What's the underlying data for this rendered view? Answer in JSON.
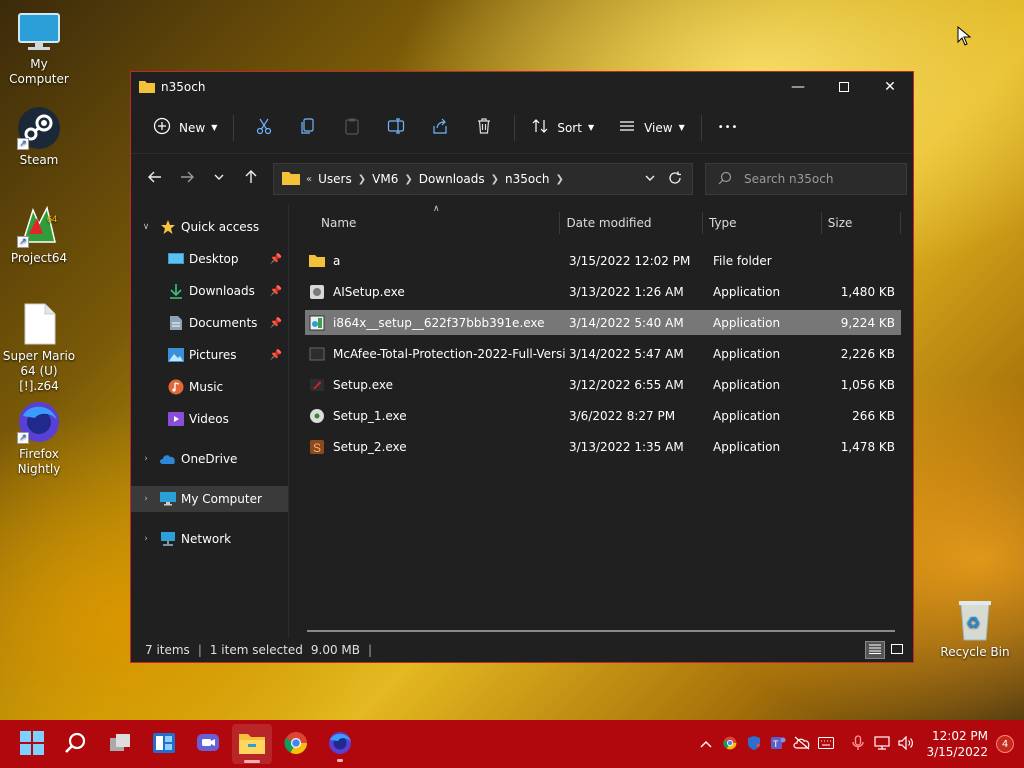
{
  "desktop": {
    "icons": [
      {
        "label": "My Computer"
      },
      {
        "label": "Steam"
      },
      {
        "label": "Project64"
      },
      {
        "label": "Super Mario 64 (U) [!].z64"
      },
      {
        "label": "Firefox Nightly"
      },
      {
        "label": "Recycle Bin"
      }
    ]
  },
  "window": {
    "title": "n35och",
    "toolbar": {
      "new_label": "New",
      "sort_label": "Sort",
      "view_label": "View",
      "more_label": "•••"
    },
    "address": {
      "overflow": "«",
      "crumbs": [
        "Users",
        "VM6",
        "Downloads",
        "n35och"
      ]
    },
    "search_placeholder": "Search n35och",
    "nav": {
      "quick_access": "Quick access",
      "desktop": "Desktop",
      "downloads": "Downloads",
      "documents": "Documents",
      "pictures": "Pictures",
      "music": "Music",
      "videos": "Videos",
      "onedrive": "OneDrive",
      "my_computer": "My Computer",
      "network": "Network"
    },
    "columns": {
      "name": "Name",
      "date": "Date modified",
      "type": "Type",
      "size": "Size"
    },
    "files": [
      {
        "name": "a",
        "date": "3/15/2022 12:02 PM",
        "type": "File folder",
        "size": "",
        "icon": "folder-icon"
      },
      {
        "name": "AISetup.exe",
        "date": "3/13/2022 1:26 AM",
        "type": "Application",
        "size": "1,480 KB",
        "icon": "setup-icon"
      },
      {
        "name": "i864x__setup__622f37bbb391e.exe",
        "date": "3/14/2022 5:40 AM",
        "type": "Application",
        "size": "9,224 KB",
        "icon": "installer-icon"
      },
      {
        "name": "McAfee-Total-Protection-2022-Full-Versi...",
        "date": "3/14/2022 5:47 AM",
        "type": "Application",
        "size": "2,226 KB",
        "icon": "blank-app-icon"
      },
      {
        "name": "Setup.exe",
        "date": "3/12/2022 6:55 AM",
        "type": "Application",
        "size": "1,056 KB",
        "icon": "red-app-icon"
      },
      {
        "name": "Setup_1.exe",
        "date": "3/6/2022 8:27 PM",
        "type": "Application",
        "size": "266 KB",
        "icon": "disc-icon"
      },
      {
        "name": "Setup_2.exe",
        "date": "3/13/2022 1:35 AM",
        "type": "Application",
        "size": "1,478 KB",
        "icon": "s-app-icon"
      }
    ],
    "status": {
      "items": "7 items",
      "selected": "1 item selected",
      "size": "9.00 MB"
    }
  },
  "taskbar": {
    "time": "12:02 PM",
    "date": "3/15/2022",
    "notifications": "4"
  },
  "colors": {
    "taskbar": "#b0080c",
    "window_bg": "#202020",
    "selected_row": "#777777",
    "window_border": "#c0282e"
  }
}
